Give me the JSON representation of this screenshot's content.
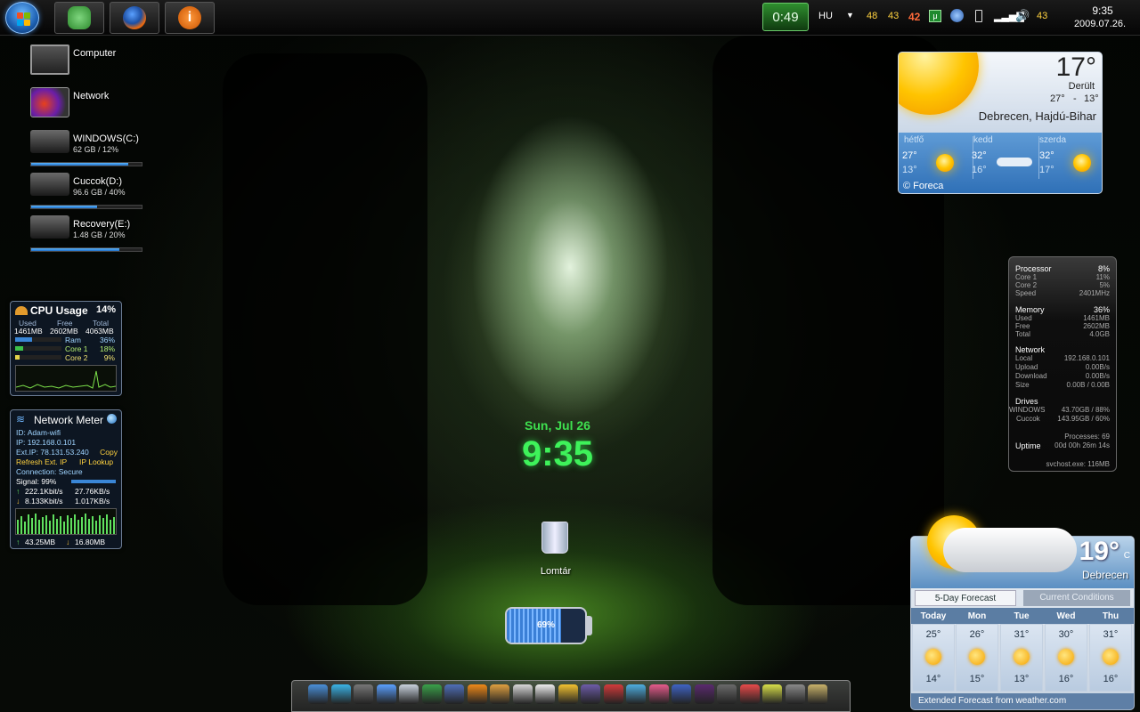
{
  "taskbar": {
    "timer": "0:49",
    "language": "HU",
    "tray_values": [
      "48",
      "43",
      "42"
    ],
    "tray_right_value": "43",
    "clock_time": "9:35",
    "clock_date": "2009.07.26."
  },
  "desktop_icons": [
    {
      "label": "Computer"
    },
    {
      "label": "Network"
    },
    {
      "label": "WINDOWS(C:)",
      "detail": "62 GB / 12%",
      "usage": 0.88
    },
    {
      "label": "Cuccok(D:)",
      "detail": "96.6 GB / 40%",
      "usage": 0.6
    },
    {
      "label": "Recovery(E:)",
      "detail": "1.48 GB / 20%",
      "usage": 0.8
    }
  ],
  "cpu_gadget": {
    "title": "CPU Usage",
    "percent": "14%",
    "headers": [
      "Used",
      "Free",
      "Total"
    ],
    "values": [
      "1461MB",
      "2602MB",
      "4063MB"
    ],
    "rows": [
      {
        "label": "Ram",
        "value": "36%",
        "level": 0.36
      },
      {
        "label": "Core 1",
        "value": "18%",
        "level": 0.18
      },
      {
        "label": "Core 2",
        "value": "9%",
        "level": 0.09
      }
    ]
  },
  "net_gadget": {
    "title": "Network Meter",
    "id": "ID: Adam-wifi",
    "ip": "IP: 192.168.0.101",
    "ext_ip": "Ext.IP: 78.131.53.240",
    "copy": "Copy",
    "refresh": "Refresh Ext. IP",
    "lookup": "IP Lookup",
    "connection": "Connection: Secure",
    "signal": "Signal: 99%",
    "signal_level": 0.99,
    "up_speed": "222.1Kbit/s",
    "up_bytes": "27.76KB/s",
    "down_speed": "8.133Kbit/s",
    "down_bytes": "1.017KB/s",
    "total_up": "43.25MB",
    "total_down": "16.80MB"
  },
  "weather_top": {
    "temp": "17°",
    "condition": "Derült",
    "range_hi": "27°",
    "range_sep": "-",
    "range_lo": "13°",
    "location": "Debrecen, Hajdú-Bihar",
    "days": [
      {
        "name": "hétfő",
        "hi": "27°",
        "lo": "13°"
      },
      {
        "name": "kedd",
        "hi": "32°",
        "lo": "16°"
      },
      {
        "name": "szerda",
        "hi": "32°",
        "lo": "17°"
      }
    ],
    "credit": "© Foreca"
  },
  "sysmon": {
    "processor": {
      "label": "Processor",
      "value": "8%",
      "core1": "Core 1",
      "core1_v": "11%",
      "core2": "Core 2",
      "core2_v": "5%",
      "speed": "Speed",
      "speed_v": "2401MHz"
    },
    "memory": {
      "label": "Memory",
      "value": "36%",
      "used": "Used",
      "used_v": "1461MB",
      "free": "Free",
      "free_v": "2602MB",
      "total": "Total",
      "total_v": "4.0GB"
    },
    "network": {
      "label": "Network",
      "local": "Local",
      "local_v": "192.168.0.101",
      "upload": "Upload",
      "upload_v": "0.00B/s",
      "download": "Download",
      "download_v": "0.00B/s",
      "size": "Size",
      "size_v": "0.00B / 0.00B"
    },
    "drives": {
      "label": "Drives",
      "d1": "WINDOWS",
      "d1_v": "43.70GB / 88%",
      "d2": "Cuccok",
      "d2_v": "143.95GB / 60%"
    },
    "processes": "Processes: 69",
    "uptime": "Uptime",
    "uptime_v": "00d 00h 26m 14s",
    "top_process": "svchost.exe: 116MB"
  },
  "desk_clock": {
    "date": "Sun, Jul 26",
    "time": "9:35"
  },
  "recycle_bin": {
    "label": "Lomtár"
  },
  "battery": {
    "percent": "69%",
    "level": 0.69
  },
  "weather_com": {
    "temp": "19°",
    "unit": "C",
    "city": "Debrecen",
    "tab_forecast": "5-Day Forecast",
    "tab_current": "Current Conditions",
    "days": [
      {
        "name": "Today",
        "hi": "25°",
        "lo": "14°"
      },
      {
        "name": "Mon",
        "hi": "26°",
        "lo": "15°"
      },
      {
        "name": "Tue",
        "hi": "31°",
        "lo": "13°"
      },
      {
        "name": "Wed",
        "hi": "30°",
        "lo": "16°"
      },
      {
        "name": "Thu",
        "hi": "31°",
        "lo": "16°"
      }
    ],
    "footer": "Extended Forecast from weather.com"
  },
  "dock_icons": [
    "finder",
    "network",
    "devices",
    "safari-globe",
    "mail",
    "utorrent",
    "floppy",
    "info",
    "menu",
    "color-cards",
    "fan",
    "pencil",
    "books",
    "lifesaver",
    "mail-bird",
    "chart",
    "document",
    "media",
    "2008",
    "calendar",
    "tennis-ball",
    "tools",
    "chess-knight"
  ],
  "colors": {
    "accent_green": "#3ef25a",
    "taskbar": "#0c0c0c",
    "bar_blue": "#2f86dd"
  }
}
